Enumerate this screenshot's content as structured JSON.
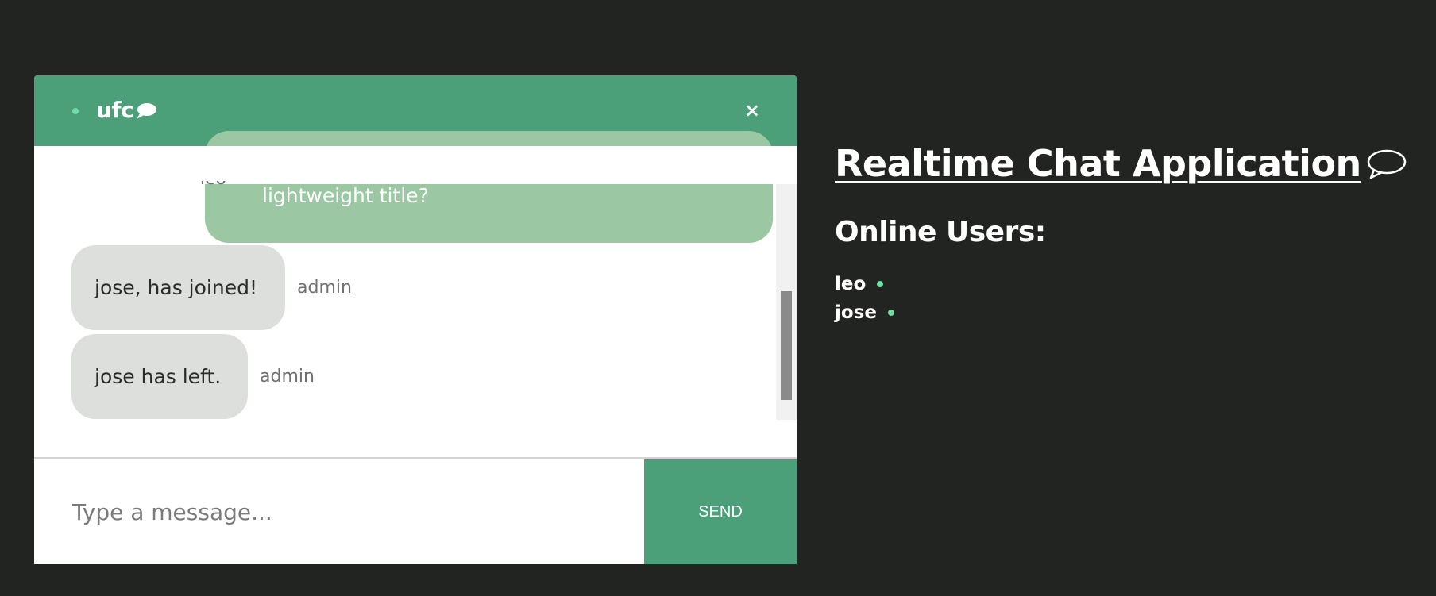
{
  "chat": {
    "room_name": "ufc",
    "close_label": "×",
    "messages": [
      {
        "sender": "leo",
        "text": "lightweight title?",
        "type": "sent"
      },
      {
        "sender": "admin",
        "text": "jose, has joined!",
        "type": "received"
      },
      {
        "sender": "admin",
        "text": "jose has left.",
        "type": "received"
      }
    ],
    "input_placeholder": "Type a message...",
    "send_label": "SEND"
  },
  "sidebar": {
    "title": "Realtime Chat Application",
    "online_heading": "Online Users:",
    "users": [
      {
        "name": "leo"
      },
      {
        "name": "jose"
      }
    ]
  },
  "icons": {
    "room_icon": "speech-bubble-icon",
    "title_icon": "speech-bubble-icon",
    "close_icon": "close-icon"
  },
  "colors": {
    "background": "#212421",
    "accent": "#4b9f79",
    "online_dot": "#6ee0a4",
    "sent_bubble": "#9bc7a2",
    "received_bubble": "#dcdfdc"
  }
}
